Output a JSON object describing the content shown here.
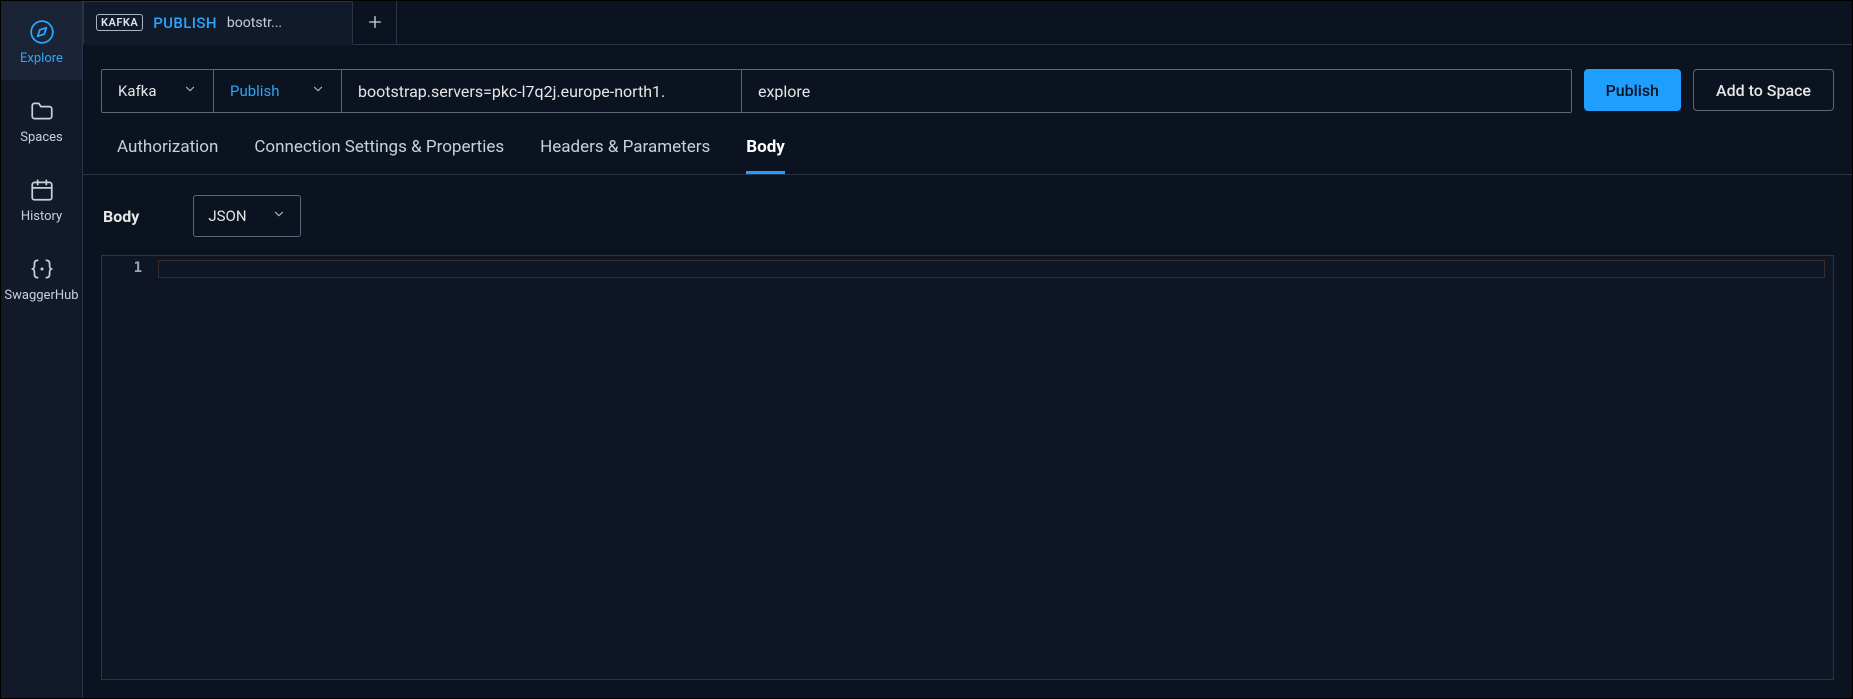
{
  "sidebar": {
    "items": [
      {
        "label": "Explore",
        "icon": "compass-icon"
      },
      {
        "label": "Spaces",
        "icon": "folder-icon"
      },
      {
        "label": "History",
        "icon": "calendar-icon"
      },
      {
        "label": "SwaggerHub",
        "icon": "braces-icon"
      }
    ],
    "activeIndex": 0
  },
  "tabs": {
    "items": [
      {
        "badge": "KAFKA",
        "method": "PUBLISH",
        "name": "bootstr..."
      }
    ],
    "add_tooltip": "+"
  },
  "urlbar": {
    "protocol": "Kafka",
    "method": "Publish",
    "server": "bootstrap.servers=pkc-l7q2j.europe-north1.",
    "topic": "explore"
  },
  "actions": {
    "publish": "Publish",
    "add_to_space": "Add to Space"
  },
  "subtabs": {
    "items": [
      "Authorization",
      "Connection Settings & Properties",
      "Headers & Parameters",
      "Body"
    ],
    "activeIndex": 3
  },
  "body": {
    "title": "Body",
    "format": "JSON",
    "editor": {
      "line_numbers": [
        "1"
      ],
      "content": ""
    }
  }
}
